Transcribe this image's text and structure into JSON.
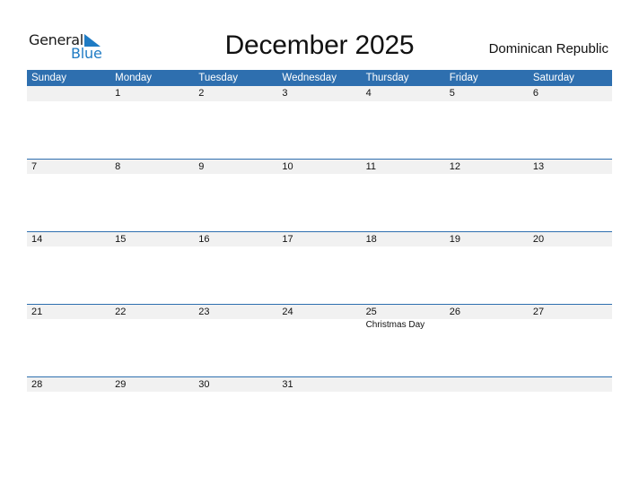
{
  "logo": {
    "text_general": "General",
    "text_blue": "Blue",
    "accent": "#1f7bc4"
  },
  "header": {
    "title": "December 2025",
    "country": "Dominican Republic"
  },
  "colors": {
    "header_bg": "#2e6faf",
    "date_strip_bg": "#f1f1f1"
  },
  "weekdays": [
    "Sunday",
    "Monday",
    "Tuesday",
    "Wednesday",
    "Thursday",
    "Friday",
    "Saturday"
  ],
  "weeks": [
    {
      "days": [
        "",
        "1",
        "2",
        "3",
        "4",
        "5",
        "6"
      ],
      "events": [
        "",
        "",
        "",
        "",
        "",
        "",
        ""
      ]
    },
    {
      "days": [
        "7",
        "8",
        "9",
        "10",
        "11",
        "12",
        "13"
      ],
      "events": [
        "",
        "",
        "",
        "",
        "",
        "",
        ""
      ]
    },
    {
      "days": [
        "14",
        "15",
        "16",
        "17",
        "18",
        "19",
        "20"
      ],
      "events": [
        "",
        "",
        "",
        "",
        "",
        "",
        ""
      ]
    },
    {
      "days": [
        "21",
        "22",
        "23",
        "24",
        "25",
        "26",
        "27"
      ],
      "events": [
        "",
        "",
        "",
        "",
        "Christmas Day",
        "",
        ""
      ]
    },
    {
      "days": [
        "28",
        "29",
        "30",
        "31",
        "",
        "",
        ""
      ],
      "events": [
        "",
        "",
        "",
        "",
        "",
        "",
        ""
      ]
    }
  ]
}
